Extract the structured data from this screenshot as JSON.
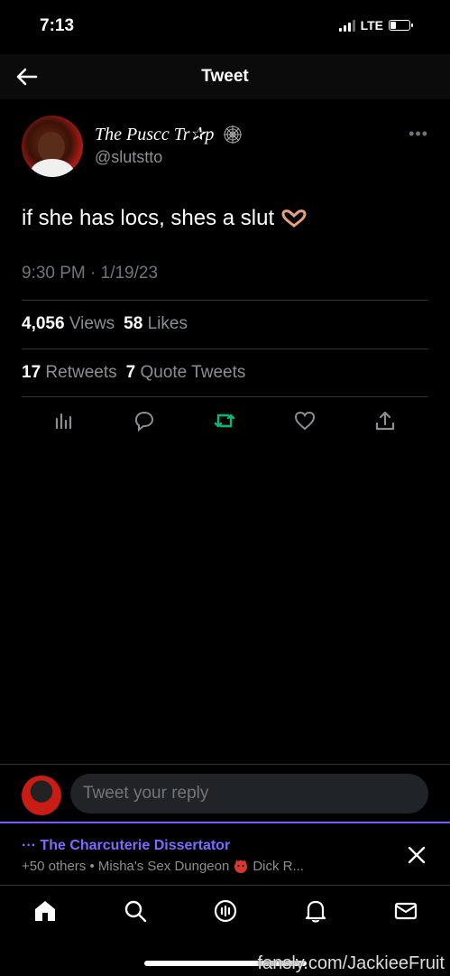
{
  "status_bar": {
    "time": "7:13",
    "network": "LTE",
    "battery_level": 0.3
  },
  "header": {
    "title": "Tweet",
    "back_icon": "arrow-left-icon"
  },
  "tweet": {
    "author": {
      "display_name": "The Puscc Tr✰p",
      "badge_icon": "spiderweb-icon",
      "handle": "@slutstto"
    },
    "text": "if she has locs, shes a slut",
    "emoji_icon": "heart-hands-icon",
    "timestamp": "9:30 PM · 1/19/23",
    "views": {
      "count": "4,056",
      "label": "Views"
    },
    "likes": {
      "count": "58",
      "label": "Likes"
    },
    "retweets": {
      "count": "17",
      "label": "Retweets"
    },
    "quote_tweets": {
      "count": "7",
      "label": "Quote Tweets"
    },
    "more_icon": "ellipsis-icon"
  },
  "actions": [
    {
      "name": "analytics-icon"
    },
    {
      "name": "reply-icon"
    },
    {
      "name": "retweet-icon",
      "color": "#00ba7c"
    },
    {
      "name": "like-icon"
    },
    {
      "name": "share-icon"
    }
  ],
  "reply": {
    "placeholder": "Tweet your reply"
  },
  "space": {
    "title": "··· The Charcuterie Dissertator",
    "subtitle_prefix": "+50 others • Misha's Sex Dungeon",
    "subtitle_suffix": "Dick R...",
    "accent": "#7856ff"
  },
  "tabbar": [
    "home-icon",
    "search-icon",
    "spaces-icon",
    "notifications-icon",
    "messages-icon"
  ],
  "watermark": "fansly.com/JackieeFruit"
}
